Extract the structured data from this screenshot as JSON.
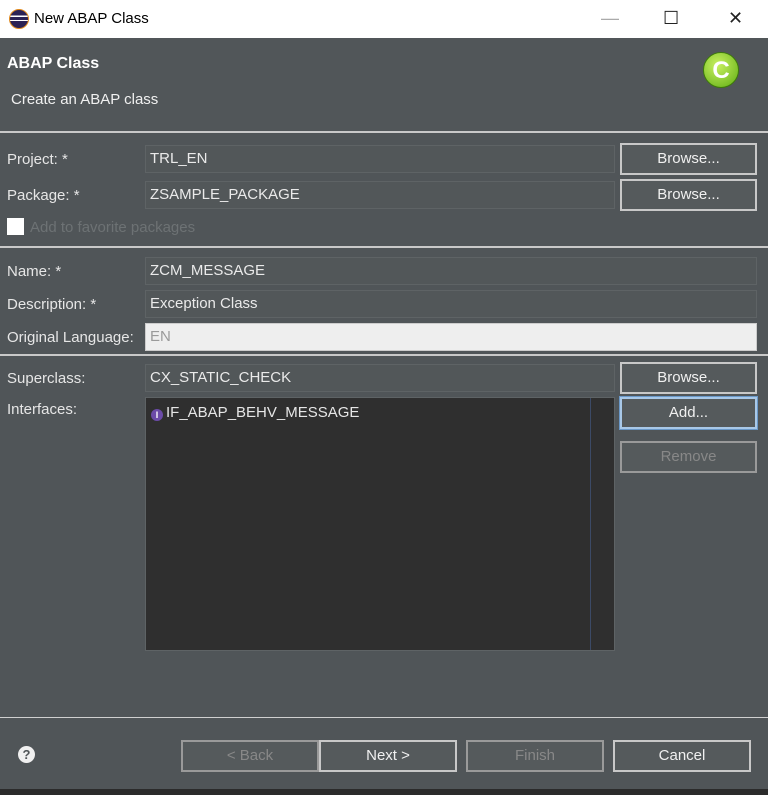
{
  "window": {
    "title": "New ABAP Class",
    "minimize": "—",
    "maximize": "☐",
    "close": "✕"
  },
  "header": {
    "title": "ABAP Class",
    "subtitle": "Create an ABAP class",
    "icon_letter": "C"
  },
  "form": {
    "project": {
      "label": "Project: *",
      "value": "TRL_EN",
      "button": "Browse..."
    },
    "package": {
      "label": "Package: *",
      "value": "ZSAMPLE_PACKAGE",
      "button": "Browse..."
    },
    "favorite": {
      "label": "Add to favorite packages",
      "checked": false
    },
    "name": {
      "label": "Name: *",
      "value": "ZCM_MESSAGE"
    },
    "description": {
      "label": "Description: *",
      "value": "Exception Class"
    },
    "original_language": {
      "label": "Original Language:",
      "value": "EN"
    },
    "superclass": {
      "label": "Superclass:",
      "value": "CX_STATIC_CHECK",
      "button": "Browse..."
    },
    "interfaces": {
      "label": "Interfaces:",
      "items": [
        "IF_ABAP_BEHV_MESSAGE"
      ],
      "add": "Add...",
      "remove": "Remove"
    }
  },
  "footer": {
    "help": "?",
    "back": "< Back",
    "next": "Next >",
    "finish": "Finish",
    "cancel": "Cancel"
  }
}
